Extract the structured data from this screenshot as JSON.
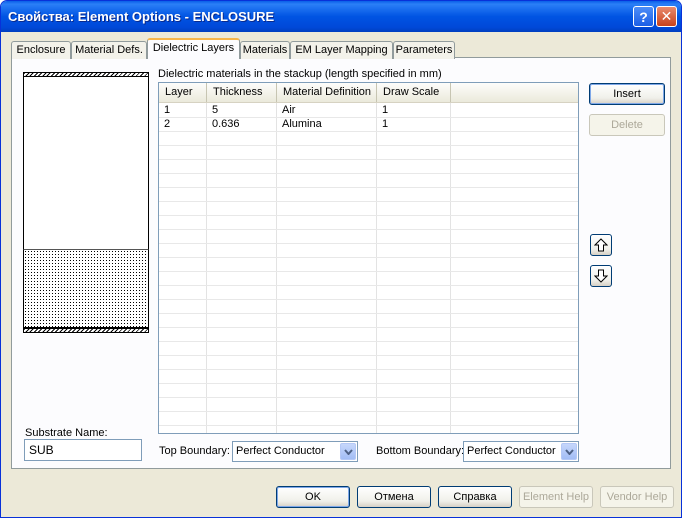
{
  "window": {
    "title": "Свойства: Element Options - ENCLOSURE",
    "help_glyph": "?",
    "close_glyph": "✕"
  },
  "tabs": [
    {
      "label": "Enclosure"
    },
    {
      "label": "Material Defs."
    },
    {
      "label": "Dielectric Layers"
    },
    {
      "label": "Materials"
    },
    {
      "label": "EM Layer Mapping"
    },
    {
      "label": "Parameters"
    }
  ],
  "active_tab": "Dielectric Layers",
  "dielectric": {
    "caption": "Dielectric materials in the stackup (length specified in mm)",
    "columns": [
      "Layer",
      "Thickness",
      "Material Definition",
      "Draw Scale"
    ],
    "rows": [
      {
        "layer": "1",
        "thickness": "5",
        "material": "Air",
        "scale": "1"
      },
      {
        "layer": "2",
        "thickness": "0.636",
        "material": "Alumina",
        "scale": "1"
      }
    ]
  },
  "side_buttons": {
    "insert": "Insert",
    "delete": "Delete",
    "move_up_icon": "arrow-up-icon",
    "move_down_icon": "arrow-down-icon"
  },
  "substrate": {
    "label": "Substrate Name:",
    "value": "SUB"
  },
  "boundaries": {
    "top_label": "Top Boundary:",
    "top_value": "Perfect Conductor",
    "bottom_label": "Bottom Boundary:",
    "bottom_value": "Perfect Conductor"
  },
  "footer": {
    "ok": "OK",
    "cancel": "Отмена",
    "help": "Справка",
    "element_help": "Element Help",
    "vendor_help": "Vendor Help"
  },
  "colors": {
    "title_bar": "#0054e3",
    "dialog_bg": "#ece9d8",
    "active_tab_accent": "#f7b64b"
  }
}
